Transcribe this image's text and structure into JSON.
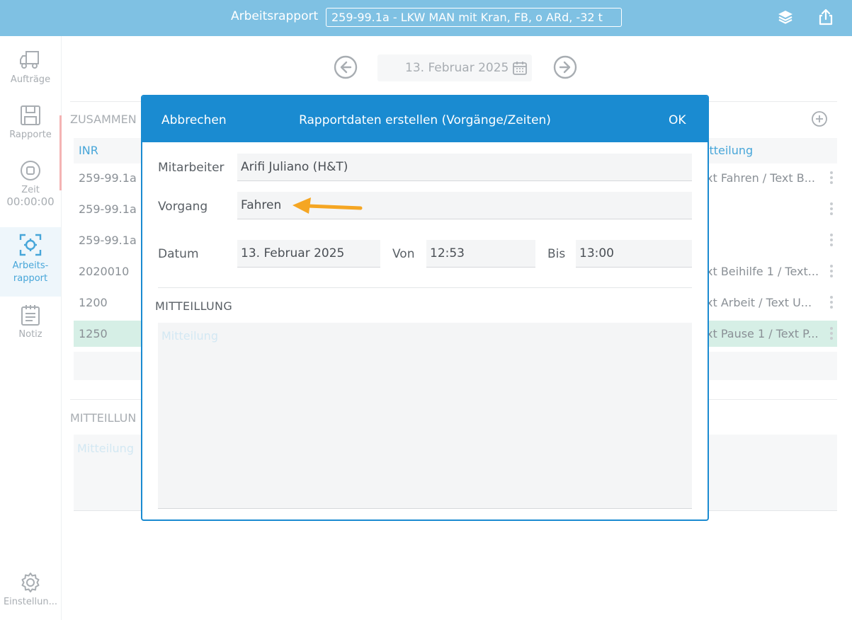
{
  "topbar": {
    "label": "Arbeitsrapport",
    "order": "259-99.1a - LKW MAN mit Kran, FB, o ARd, -32 t",
    "icons": [
      "layers-icon",
      "share-icon"
    ]
  },
  "sidebar": {
    "items": [
      {
        "label": "Aufträge",
        "icon": "truck-icon"
      },
      {
        "label": "Rapporte",
        "icon": "save-icon"
      },
      {
        "label": "Zeit",
        "sub": "00:00:00",
        "icon": "stop-icon"
      },
      {
        "label": "Arbeits-\nrapport",
        "icon": "scan-icon"
      },
      {
        "label": "Notiz",
        "icon": "notepad-icon"
      },
      {
        "label": "Einstellun...",
        "icon": "gear-icon"
      }
    ],
    "active_color": "#47a6d9"
  },
  "datenav": {
    "date": "13. Februar 2025"
  },
  "background": {
    "summary_label": "ZUSAMMEN",
    "columns": {
      "inr": "INR",
      "msg": "itteilung"
    },
    "rows": [
      {
        "inr": "259-99.1a",
        "msg": "xt Fahren / Text B..."
      },
      {
        "inr": "259-99.1a",
        "msg": ""
      },
      {
        "inr": "259-99.1a",
        "msg": ""
      },
      {
        "inr": "2020010",
        "msg": "xt Beihilfe 1 / Text..."
      },
      {
        "inr": "1200",
        "msg": "xt Arbeit / Text U..."
      },
      {
        "inr": "1250",
        "msg": "xt Pause 1 / Text P...",
        "selected": true
      }
    ],
    "message_label": "MITTEILLUN",
    "message_placeholder": "Mitteilung"
  },
  "modal": {
    "cancel": "Abbrechen",
    "title": "Rapportdaten erstellen (Vorgänge/Zeiten)",
    "ok": "OK",
    "employee_label": "Mitarbeiter",
    "employee_value": "Arifi Juliano (H&T)",
    "process_label": "Vorgang",
    "process_value": "Fahren",
    "date_label": "Datum",
    "date_value": "13. Februar 2025",
    "from_label": "Von",
    "from_value": "12:53",
    "to_label": "Bis",
    "to_value": "13:00",
    "message_label": "MITTEILLUNG",
    "message_placeholder": "Mitteilung",
    "header_color": "#1a8bd1",
    "arrow_color": "#f5a623"
  }
}
